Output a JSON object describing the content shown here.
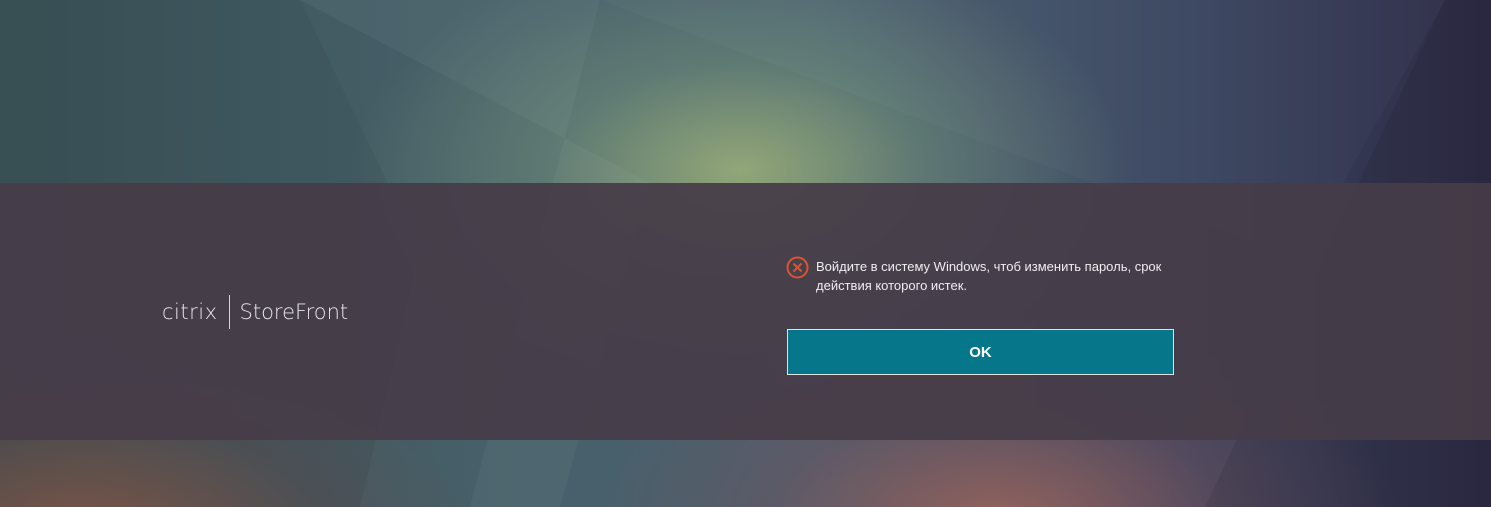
{
  "logo": {
    "brand": "citrix",
    "product": "StoreFront"
  },
  "message": {
    "icon": "error-circle-x-icon",
    "text": "Войдите в систему Windows, чтоб изменить пароль, срок действия которого истек."
  },
  "actions": {
    "ok_label": "OK"
  },
  "colors": {
    "button": "#06778b",
    "error_icon": "#e0522e",
    "band": "#463c48"
  }
}
